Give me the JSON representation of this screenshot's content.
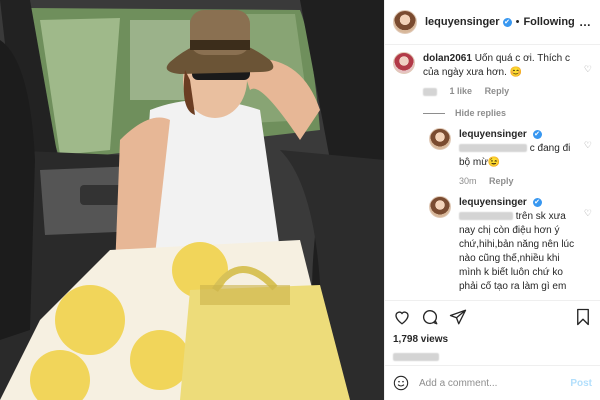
{
  "header": {
    "username": "lequyensinger",
    "verified_mark": "✔",
    "separator": "•",
    "follow_label": "Following",
    "more_label": "…"
  },
  "comments": [
    {
      "username": "dolan2061",
      "text": "Uốn quá c ơi. Thích c của ngày xưa hơn. 😊",
      "likes": "1 like",
      "reply_label": "Reply"
    }
  ],
  "hide_replies_label": "Hide replies",
  "replies": [
    {
      "username": "lequyensinger",
      "text": "c đang đi bộ mừ😉",
      "time": "30m",
      "reply_label": "Reply"
    },
    {
      "username": "lequyensinger",
      "text": "trên sk xưa nay chị còn điệu hơn ý chứ,hihi,bản năng nên lúc nào cũng thế,nhiều khi mình k biết luôn chứ ko phải cố tạo ra làm gì em ơi",
      "time": "",
      "reply_label": ""
    }
  ],
  "post": {
    "views": "1,798 views"
  },
  "add_comment": {
    "placeholder": "Add a comment...",
    "post_label": "Post"
  },
  "icons": {
    "heart": "heart-icon",
    "comment": "comment-icon",
    "share": "share-icon",
    "save": "bookmark-icon",
    "emoji": "emoji-icon"
  },
  "colors": {
    "accent": "#3897f0",
    "post_disabled": "#b2dffc",
    "muted": "#8e8e8e"
  }
}
